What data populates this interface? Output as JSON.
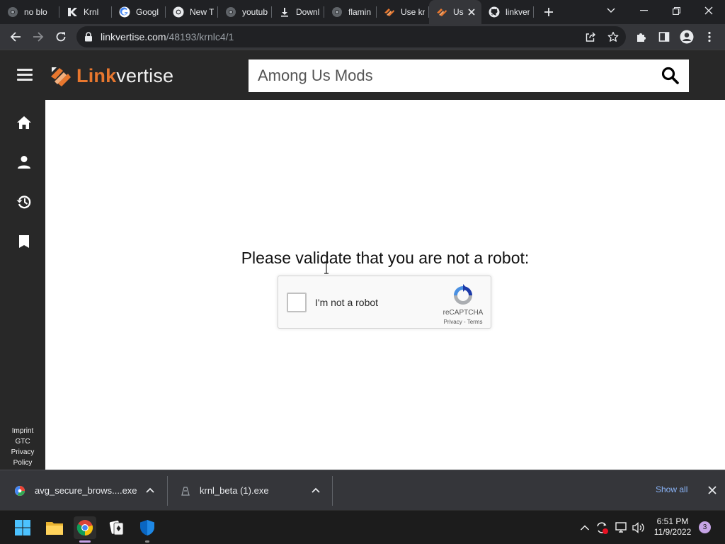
{
  "browser": {
    "tabs": [
      {
        "title": "no blo",
        "favicon": "chrome-globe-icon"
      },
      {
        "title": "Krnl",
        "favicon": "krnl-icon"
      },
      {
        "title": "Googl",
        "favicon": "google-icon"
      },
      {
        "title": "New T",
        "favicon": "chrome-icon"
      },
      {
        "title": "youtub",
        "favicon": "chrome-globe-icon"
      },
      {
        "title": "Downl",
        "favicon": "download-icon"
      },
      {
        "title": "flamin",
        "favicon": "chrome-globe-icon"
      },
      {
        "title": "Use kr",
        "favicon": "linkvertise-icon"
      },
      {
        "title": "Us",
        "favicon": "linkvertise-icon",
        "active": true
      },
      {
        "title": "linkver",
        "favicon": "github-icon"
      }
    ],
    "url_host": "linkvertise.com",
    "url_path": "/48193/krnlc4/1"
  },
  "site": {
    "logo_link": "Link",
    "logo_vertise": "vertise",
    "search_value": "Among Us Mods",
    "footer_links": [
      "Imprint",
      "GTC",
      "Privacy",
      "Policy"
    ],
    "brand_color": "#e8772e"
  },
  "main": {
    "heading": "Please validate that you are not a robot:"
  },
  "captcha": {
    "label": "I'm not a robot",
    "brand": "reCAPTCHA",
    "privacy": "Privacy",
    "separator": " - ",
    "terms": "Terms"
  },
  "downloads": {
    "items": [
      "avg_secure_brows....exe",
      "krnl_beta (1).exe"
    ],
    "show_all": "Show all"
  },
  "taskbar": {
    "time": "6:51 PM",
    "date": "11/9/2022",
    "notifications": "3"
  }
}
